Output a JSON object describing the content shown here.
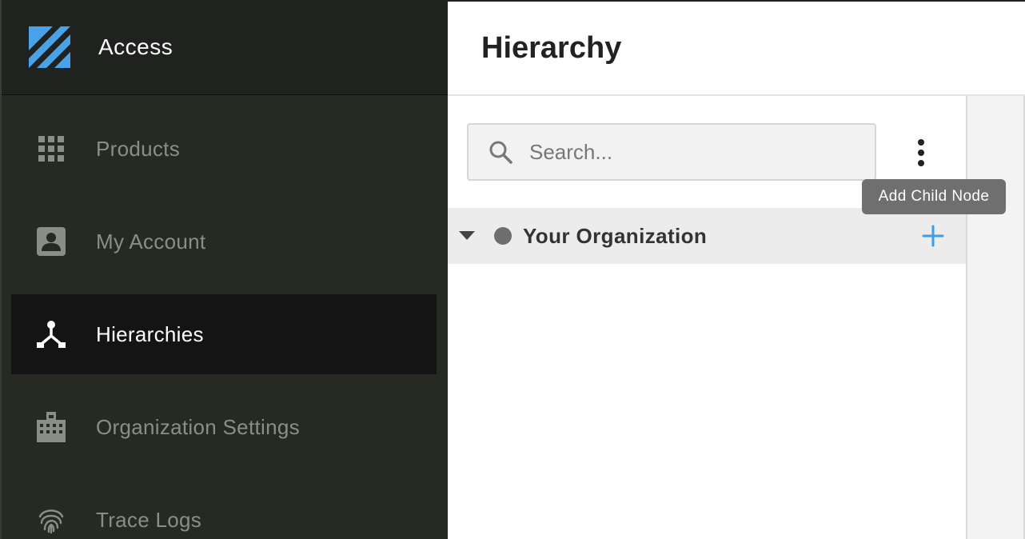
{
  "app": {
    "title": "Access",
    "logo_icon": "access-logo",
    "brand_color": "#4aa3e8"
  },
  "sidebar": {
    "items": [
      {
        "label": "Products",
        "icon": "grid-icon",
        "active": false
      },
      {
        "label": "My Account",
        "icon": "account-box-icon",
        "active": false
      },
      {
        "label": "Hierarchies",
        "icon": "hierarchy-icon",
        "active": true
      },
      {
        "label": "Organization Settings",
        "icon": "building-icon",
        "active": false
      },
      {
        "label": "Trace Logs",
        "icon": "fingerprint-icon",
        "active": false
      }
    ]
  },
  "main": {
    "title": "Hierarchy",
    "search": {
      "placeholder": "Search...",
      "value": ""
    },
    "tree": {
      "root": {
        "label": "Your Organization",
        "expanded": true
      }
    },
    "tooltip": "Add Child Node",
    "accent_color": "#3d9ee6"
  }
}
